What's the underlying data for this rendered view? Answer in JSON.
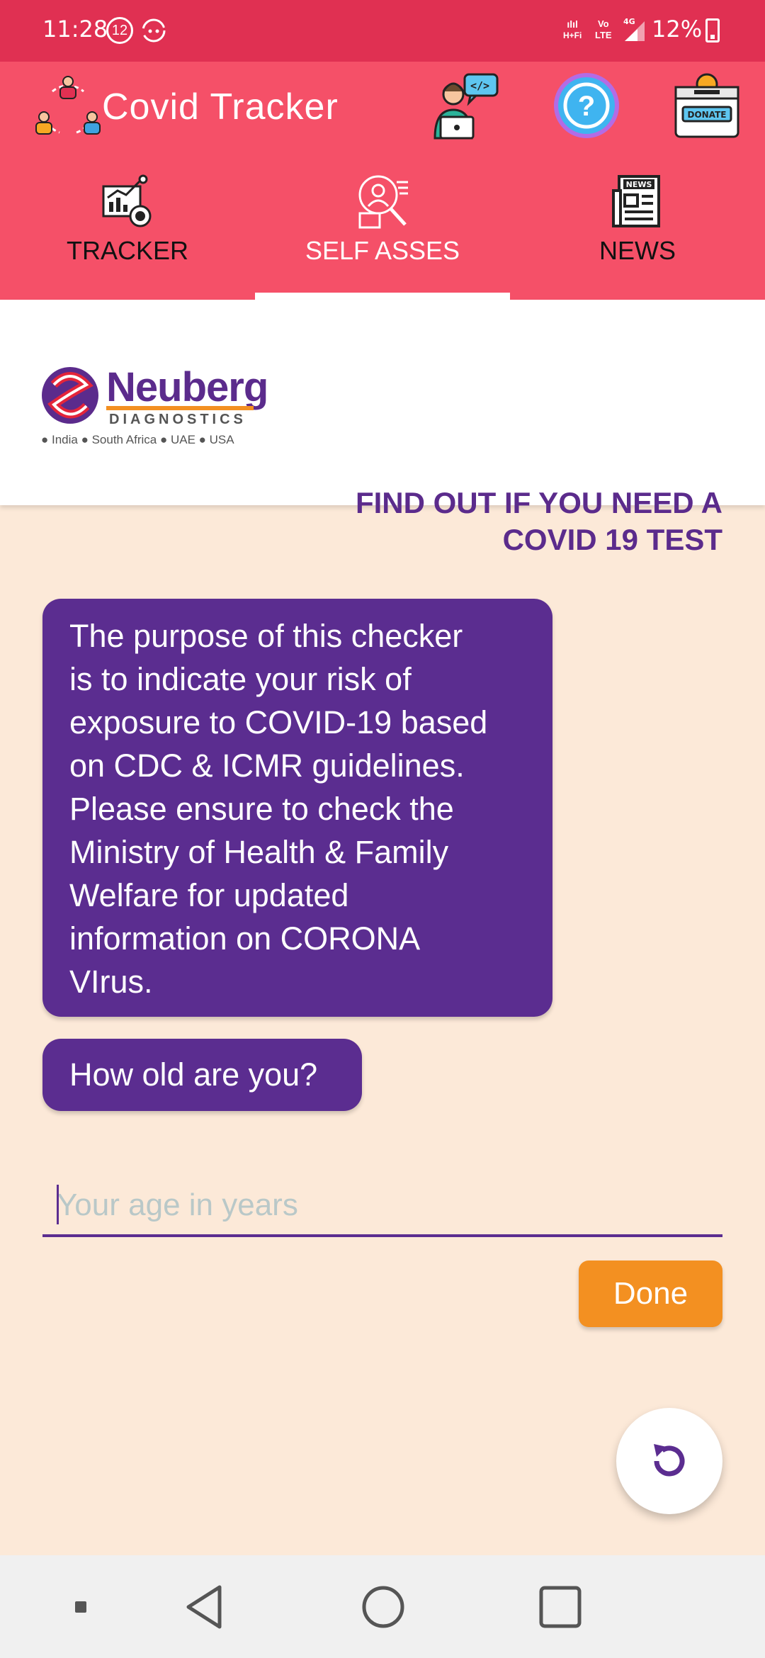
{
  "status_bar": {
    "time": "11:28",
    "notification_badge": "12",
    "network_type": "H+ H-Fi",
    "volte": "Vo LTE",
    "signal_label": "4G",
    "battery": "12%"
  },
  "header": {
    "title": "Covid Tracker",
    "donate_label": "DONATE",
    "icons": [
      "people-cycle-icon",
      "developer-icon",
      "help-icon",
      "donate-box-icon"
    ]
  },
  "tabs": [
    {
      "label": "TRACKER",
      "icon": "chart-report-icon",
      "active": false
    },
    {
      "label": "SELF ASSES",
      "icon": "self-assessment-icon",
      "active": true
    },
    {
      "label": "NEWS",
      "icon": "newspaper-icon",
      "active": false
    }
  ],
  "news_icon_label": "NEWS",
  "brand": {
    "name": "Neuberg",
    "subtitle": "DIAGNOSTICS",
    "locations": "● India ● South Africa ● UAE ● USA"
  },
  "headline": {
    "line1": "FIND OUT IF YOU NEED A",
    "line2": "COVID 19 TEST"
  },
  "chat": {
    "intro_lines": [
      "The purpose of this checker",
      "is to indicate your risk of",
      "exposure to COVID-19 based",
      "on CDC & ICMR guidelines.",
      "Please ensure to check the",
      "Ministry of Health & Family",
      "Welfare for updated",
      "information on CORONA",
      "VIrus."
    ],
    "question": "How old are you?"
  },
  "age_input": {
    "value": "",
    "placeholder": "Your age in years"
  },
  "done_label": "Done",
  "colors": {
    "status_bar": "#e03052",
    "app_bar": "#f55068",
    "purple": "#5b2d90",
    "orange": "#f39021",
    "background": "#fce9d8"
  }
}
